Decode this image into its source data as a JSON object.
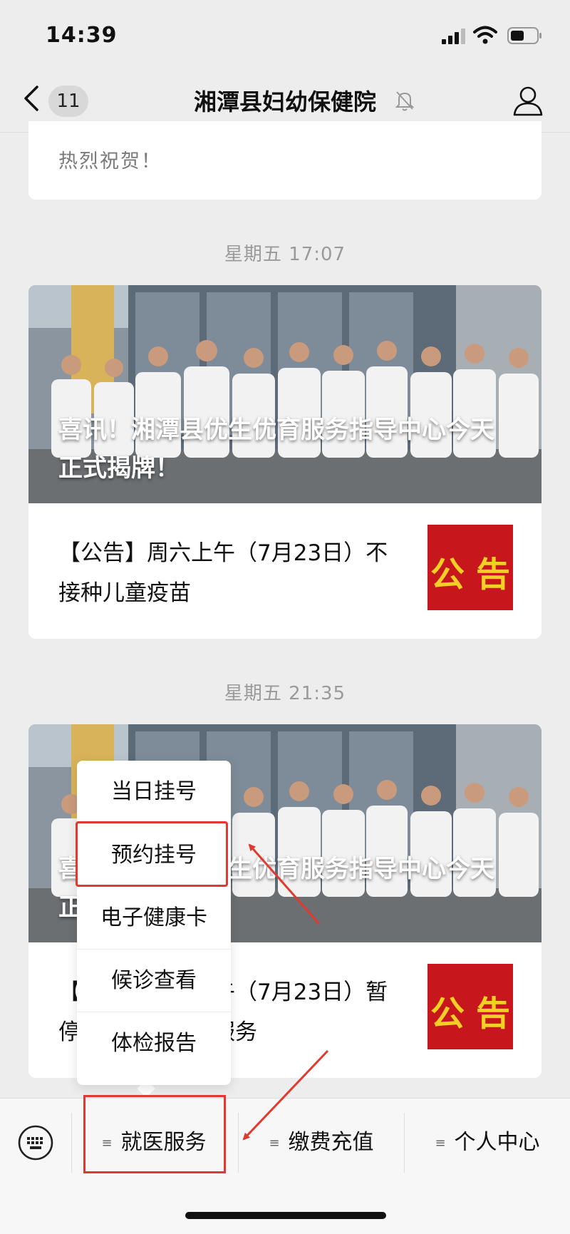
{
  "status_bar": {
    "time": "14:39"
  },
  "nav": {
    "unread_count": "11",
    "title": "湘潭县妇幼保健院"
  },
  "messages": {
    "previous_text": "热烈祝贺！",
    "group_1": {
      "time": "星期五 17:07",
      "headline": "喜讯！湘潭县优生优育服务指导中心今天正式揭牌！",
      "sub_title": "【公告】周六上午（7月23日）不接种儿童疫苗",
      "thumb_chars": [
        "公",
        "告"
      ]
    },
    "group_2": {
      "time": "星期五 21:35",
      "headline": "喜讯！湘潭县优生优育服务指导中心今天正式揭牌！",
      "sub_title": "【公告】周六上午（7月23日）暂停儿童预防接种服务",
      "thumb_chars": [
        "公",
        "告"
      ]
    }
  },
  "popup_menu": {
    "items": [
      "当日挂号",
      "预约挂号",
      "电子健康卡",
      "候诊查看",
      "体检报告"
    ],
    "highlighted": "预约挂号"
  },
  "bottom_menu": {
    "tabs": [
      "就医服务",
      "缴费充值",
      "个人中心"
    ],
    "highlighted": "就医服务"
  },
  "colors": {
    "accent_red": "#e03a2f",
    "notice_red": "#c8161d",
    "notice_gold": "#f4d026"
  },
  "icons": [
    "back-icon",
    "mute-bell-icon",
    "profile-icon",
    "keyboard-icon",
    "menu-glyph-icon",
    "signal-icon",
    "wifi-icon",
    "battery-icon"
  ]
}
